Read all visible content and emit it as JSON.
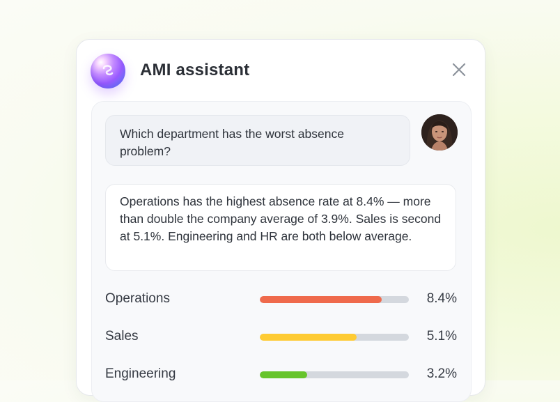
{
  "assistant": {
    "title": "AMI assistant",
    "logo_icon": "ami-orb-logo",
    "close_icon": "close-icon"
  },
  "conversation": {
    "user_question": "Which department has the worst absence problem?",
    "assistant_answer": "Operations has the highest absence rate at 8.4% — more than double the company average of 3.9%. Sales is second at 5.1%. Engineering and HR are both below average."
  },
  "departments": [
    {
      "name": "Operations",
      "value_label": "8.4%",
      "value": 8.4,
      "bar_fraction": 0.82,
      "color": "#ef6a4c"
    },
    {
      "name": "Sales",
      "value_label": "5.1%",
      "value": 5.1,
      "bar_fraction": 0.65,
      "color": "#fecb33"
    },
    {
      "name": "Engineering",
      "value_label": "3.2%",
      "value": 3.2,
      "bar_fraction": 0.32,
      "color": "#66c42b"
    }
  ]
}
